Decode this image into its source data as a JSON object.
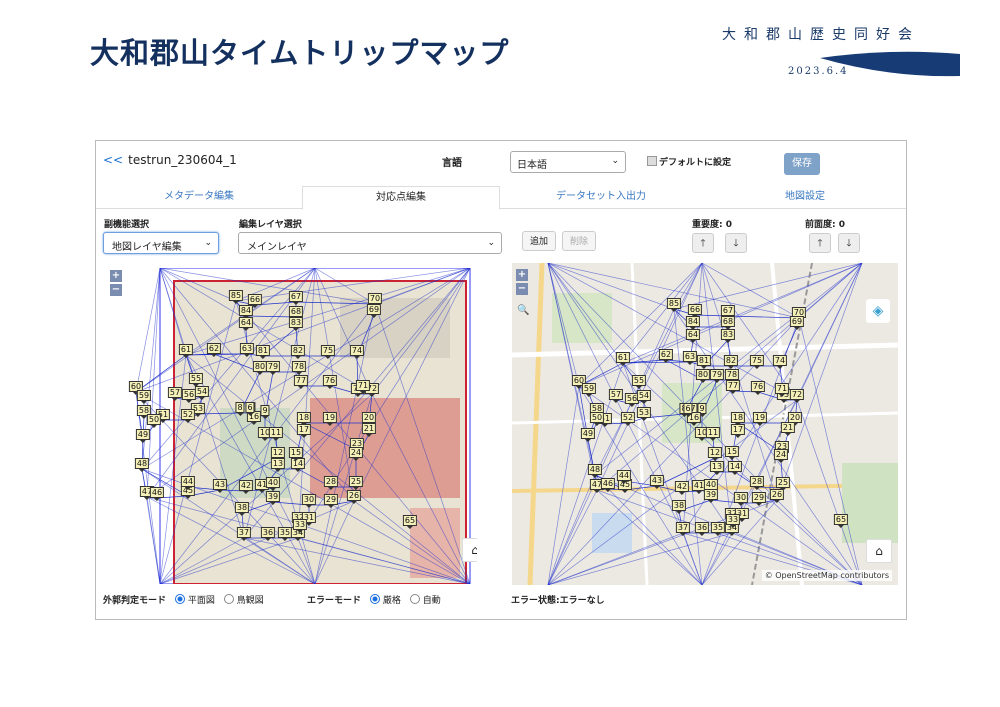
{
  "slide": {
    "title": "大和郡山タイムトリップマップ",
    "org_name": "大和郡山歴史同好会",
    "date": "2023.6.4"
  },
  "app": {
    "back_arrows": "<<",
    "record_name": "testrun_230604_1",
    "language_label": "言語",
    "language_value": "日本語",
    "default_label": "デフォルトに設定",
    "save_label": "保存",
    "tabs": [
      "メタデータ編集",
      "対応点編集",
      "データセット入出力",
      "地図設定"
    ],
    "active_tab": 1,
    "sub_function_label": "副機能選択",
    "sub_function_value": "地図レイヤ編集",
    "edit_layer_label": "編集レイヤ選択",
    "edit_layer_value": "メインレイヤ",
    "add_label": "追加",
    "delete_label": "削除",
    "importance_label": "重要度: 0",
    "front_label": "前面度: 0",
    "up_glyph": "🡑",
    "down_glyph": "🡓",
    "outer_mode_label": "外郭判定モード",
    "outer_mode_options": [
      "平面図",
      "鳥観図"
    ],
    "error_mode_label": "エラーモード",
    "error_mode_options": [
      "厳格",
      "自動"
    ],
    "error_status": "エラー状態:エラーなし",
    "osm_attribution": "© OpenStreetMap contributors",
    "zoom_in": "+",
    "zoom_out": "−",
    "home_icon_glyph": "⌂",
    "layers_glyph": "◈",
    "search_glyph": "🔍"
  },
  "colors": {
    "title": "#13305e",
    "link": "#1e6fd0",
    "accent_blue": "#2233cc",
    "save_button": "#7fa2c8",
    "marker_fill": "#f4f0b8"
  },
  "gcp_labels": [
    "85",
    "66",
    "67",
    "70",
    "84",
    "68",
    "69",
    "64",
    "83",
    "61",
    "62",
    "63",
    "81",
    "82",
    "75",
    "74",
    "60",
    "59",
    "80",
    "79",
    "78",
    "77",
    "76",
    "73",
    "72",
    "55",
    "57",
    "56",
    "54",
    "58",
    "53",
    "52",
    "51",
    "50",
    "8",
    "7",
    "9",
    "16",
    "18",
    "19",
    "20",
    "49",
    "10",
    "11",
    "17",
    "21",
    "22",
    "23",
    "24",
    "12",
    "13",
    "14",
    "15",
    "48",
    "47",
    "46",
    "45",
    "44",
    "43",
    "42",
    "41",
    "40",
    "39",
    "28",
    "25",
    "26",
    "30",
    "29",
    "38",
    "32",
    "31",
    "37",
    "36",
    "35",
    "34",
    "33",
    "71",
    "65",
    "6"
  ]
}
